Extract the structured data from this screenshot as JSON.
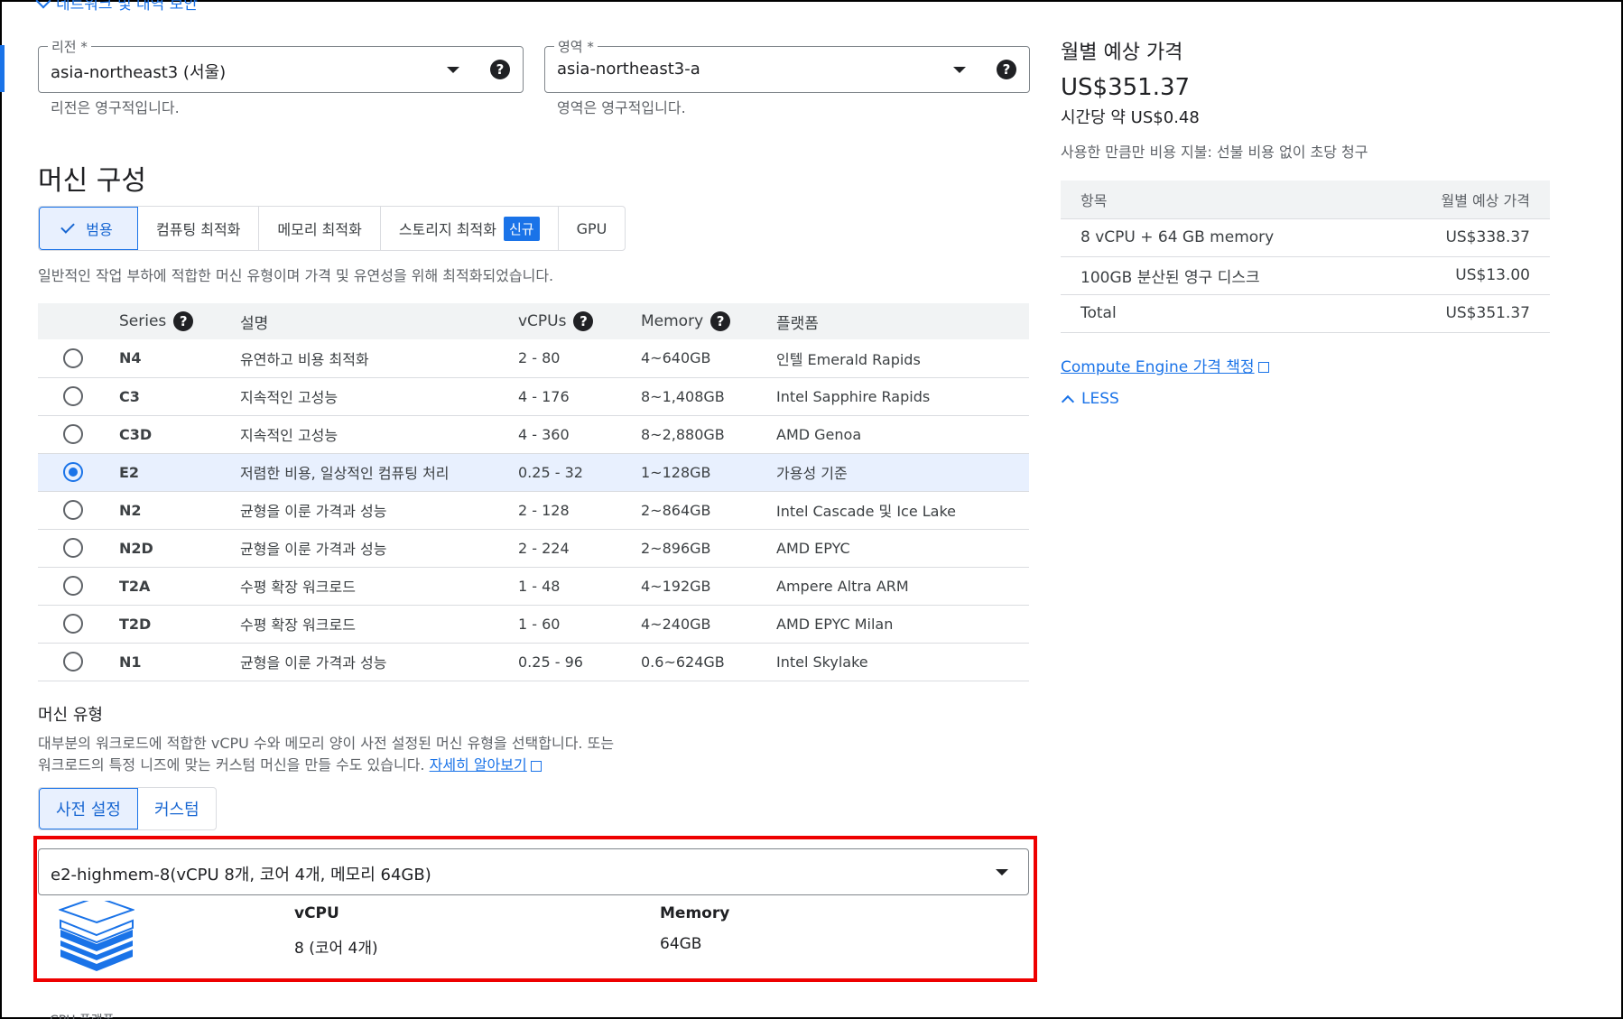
{
  "top_link": {
    "label": "네트워크 및 대역 보안"
  },
  "region": {
    "label": "리전 *",
    "value": "asia-northeast3 (서울)",
    "hint": "리전은 영구적입니다."
  },
  "zone": {
    "label": "영역 *",
    "value": "asia-northeast3-a",
    "hint": "영역은 영구적입니다."
  },
  "machine_config": {
    "title": "머신 구성",
    "tabs": [
      {
        "label": "범용",
        "active": true
      },
      {
        "label": "컴퓨팅 최적화"
      },
      {
        "label": "메모리 최적화"
      },
      {
        "label": "스토리지 최적화",
        "badge": "신규"
      },
      {
        "label": "GPU"
      }
    ],
    "description": "일반적인 작업 부하에 적합한 머신 유형이며 가격 및 유연성을 위해 최적화되었습니다."
  },
  "series_table": {
    "headers": {
      "series": "Series",
      "desc": "설명",
      "vcpus": "vCPUs",
      "memory": "Memory",
      "platform": "플랫폼"
    },
    "rows": [
      {
        "series": "N4",
        "desc": "유연하고 비용 최적화",
        "vcpus": "2 - 80",
        "memory": "4~640GB",
        "platform": "인텔 Emerald Rapids"
      },
      {
        "series": "C3",
        "desc": "지속적인 고성능",
        "vcpus": "4 - 176",
        "memory": "8~1,408GB",
        "platform": "Intel Sapphire Rapids"
      },
      {
        "series": "C3D",
        "desc": "지속적인 고성능",
        "vcpus": "4 - 360",
        "memory": "8~2,880GB",
        "platform": "AMD Genoa"
      },
      {
        "series": "E2",
        "desc": "저렴한 비용, 일상적인 컴퓨팅 처리",
        "vcpus": "0.25 - 32",
        "memory": "1~128GB",
        "platform": "가용성 기준",
        "selected": true
      },
      {
        "series": "N2",
        "desc": "균형을 이룬 가격과 성능",
        "vcpus": "2 - 128",
        "memory": "2~864GB",
        "platform": "Intel Cascade 및 Ice Lake"
      },
      {
        "series": "N2D",
        "desc": "균형을 이룬 가격과 성능",
        "vcpus": "2 - 224",
        "memory": "2~896GB",
        "platform": "AMD EPYC"
      },
      {
        "series": "T2A",
        "desc": "수평 확장 워크로드",
        "vcpus": "1 - 48",
        "memory": "4~192GB",
        "platform": "Ampere Altra ARM"
      },
      {
        "series": "T2D",
        "desc": "수평 확장 워크로드",
        "vcpus": "1 - 60",
        "memory": "4~240GB",
        "platform": "AMD EPYC Milan"
      },
      {
        "series": "N1",
        "desc": "균형을 이룬 가격과 성능",
        "vcpus": "0.25 - 96",
        "memory": "0.6~624GB",
        "platform": "Intel Skylake"
      }
    ]
  },
  "machine_type": {
    "title": "머신 유형",
    "desc_line1": "대부분의 워크로드에 적합한 vCPU 수와 메모리 양이 사전 설정된 머신 유형을 선택합니다. 또는",
    "desc_line2": "워크로드의 특정 니즈에 맞는 커스텀 머신을 만들 수도 있습니다.",
    "learn_more": "자세히 알아보기",
    "toggle": {
      "preset": "사전 설정",
      "custom": "커스텀"
    },
    "selected": "e2-highmem-8(vCPU 8개, 코어 4개, 메모리 64GB)",
    "vcpu_label": "vCPU",
    "vcpu_value": "8 (코어 4개)",
    "memory_label": "Memory",
    "memory_value": "64GB",
    "cut_label": "CPU 플랫폼"
  },
  "pricing": {
    "title": "월별 예상 가격",
    "monthly": "US$351.37",
    "hourly": "시간당 약 US$0.48",
    "note": "사용한 만큼만 비용 지불: 선불 비용 없이 초당 청구",
    "headers": {
      "item": "항목",
      "price": "월별 예상 가격"
    },
    "rows": [
      {
        "item": "8 vCPU + 64 GB memory",
        "price": "US$338.37"
      },
      {
        "item": "100GB 분산된 영구 디스크",
        "price": "US$13.00"
      }
    ],
    "total": {
      "item": "Total",
      "price": "US$351.37"
    },
    "link": "Compute Engine 가격 책정",
    "less": "LESS"
  },
  "colors": {
    "accent": "#1a73e8",
    "highlight": "#e00000",
    "selected_row": "#e8f0fe"
  }
}
